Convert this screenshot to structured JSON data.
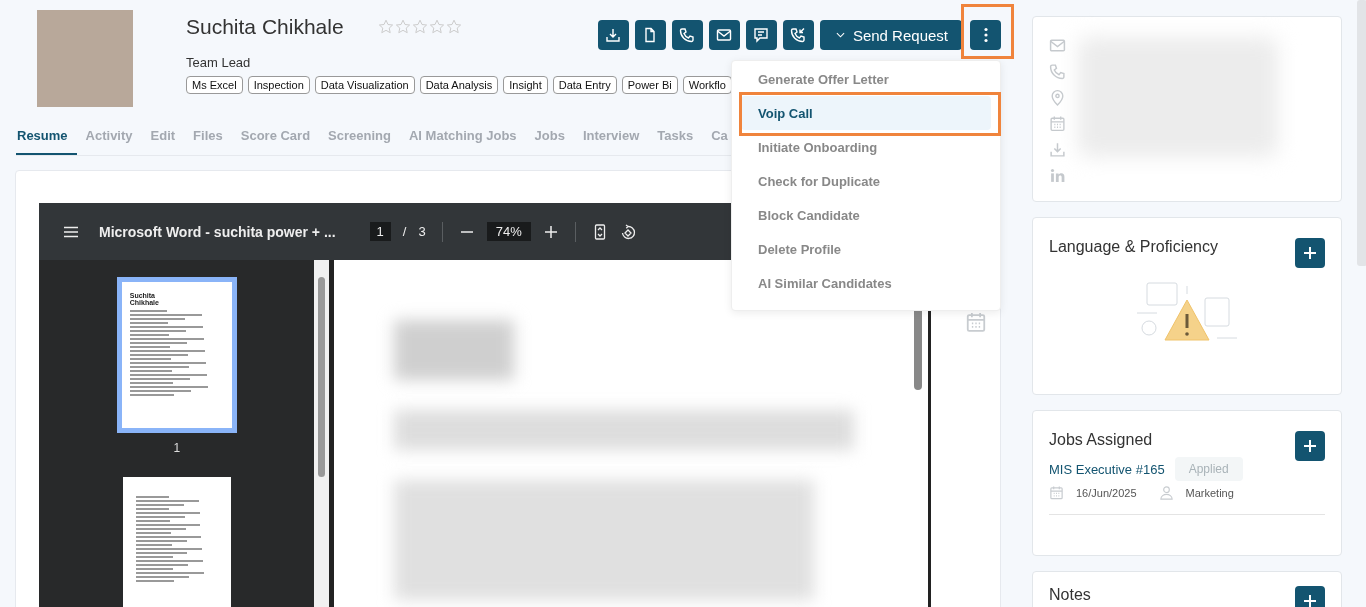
{
  "candidate": {
    "name": "Suchita Chikhale",
    "stars": 0,
    "role": "Team Lead",
    "skills": [
      "Ms Excel",
      "Inspection",
      "Data Visualization",
      "Data Analysis",
      "Insight",
      "Data Entry",
      "Power Bi",
      "Workflo"
    ]
  },
  "actions": {
    "icon_buttons": [
      {
        "kind": "download"
      },
      {
        "kind": "document"
      },
      {
        "kind": "phone"
      },
      {
        "kind": "mail"
      },
      {
        "kind": "message"
      },
      {
        "kind": "voip"
      }
    ],
    "send_request": "Send Request",
    "more_highlighted": true
  },
  "more_menu": [
    {
      "label": "Generate Offer Letter",
      "selected": false,
      "highlighted": false
    },
    {
      "label": "Voip Call",
      "selected": true,
      "highlighted": true
    },
    {
      "label": "Initiate Onboarding",
      "selected": false,
      "highlighted": false
    },
    {
      "label": "Check for Duplicate",
      "selected": false,
      "highlighted": false
    },
    {
      "label": "Block Candidate",
      "selected": false,
      "highlighted": false
    },
    {
      "label": "Delete Profile",
      "selected": false,
      "highlighted": false
    },
    {
      "label": "AI Similar Candidates",
      "selected": false,
      "highlighted": false
    }
  ],
  "tabs": [
    {
      "label": "Resume",
      "selected": true
    },
    {
      "label": "Activity",
      "selected": false
    },
    {
      "label": "Edit",
      "selected": false
    },
    {
      "label": "Files",
      "selected": false
    },
    {
      "label": "Score Card",
      "selected": false
    },
    {
      "label": "Screening",
      "selected": false
    },
    {
      "label": "AI Matching Jobs",
      "selected": false
    },
    {
      "label": "Jobs",
      "selected": false
    },
    {
      "label": "Interview",
      "selected": false
    },
    {
      "label": "Tasks",
      "selected": false
    },
    {
      "label": "Ca",
      "selected": false
    }
  ],
  "pdf_viewer": {
    "title": "Microsoft Word - suchita power + ...",
    "page": "1",
    "separator": "/",
    "page_count": "3",
    "zoom": "74%",
    "thumbnails": [
      {
        "label": "1",
        "selected": true,
        "heading": "Suchita Chikhale"
      },
      {
        "selected": false
      }
    ]
  },
  "contact_card": {
    "rows": [
      {
        "kind": "mail"
      },
      {
        "kind": "phone"
      },
      {
        "kind": "location"
      },
      {
        "kind": "calendar"
      },
      {
        "kind": "download"
      },
      {
        "kind": "linkedin"
      }
    ]
  },
  "language_card": {
    "title": "Language & Proficiency"
  },
  "jobs_card": {
    "title": "Jobs Assigned",
    "jobs": [
      {
        "title": "MIS Executive #165",
        "status": "Applied",
        "date": "16/Jun/2025",
        "department": "Marketing"
      }
    ]
  },
  "notes_card": {
    "title": "Notes"
  }
}
